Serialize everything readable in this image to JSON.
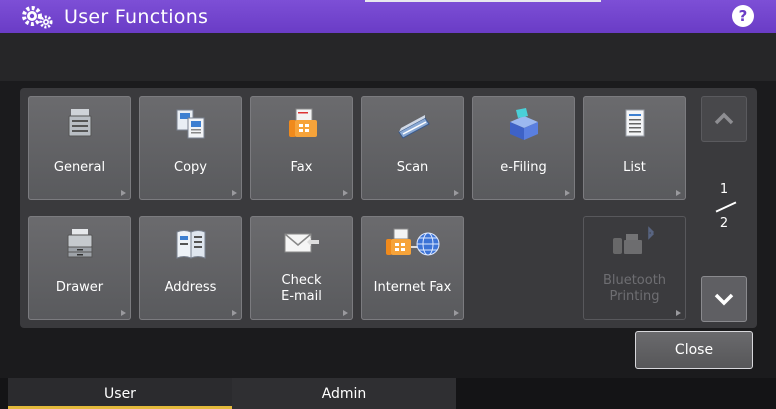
{
  "header": {
    "title": "User Functions",
    "help_label": "?"
  },
  "tiles": [
    {
      "label": "General",
      "icon": "copier-icon",
      "enabled": true
    },
    {
      "label": "Copy",
      "icon": "copy-pages-icon",
      "enabled": true
    },
    {
      "label": "Fax",
      "icon": "fax-icon",
      "enabled": true
    },
    {
      "label": "Scan",
      "icon": "scanner-icon",
      "enabled": true
    },
    {
      "label": "e-Filing",
      "icon": "e-filing-box-icon",
      "enabled": true
    },
    {
      "label": "List",
      "icon": "list-document-icon",
      "enabled": true
    },
    {
      "label": "Drawer",
      "icon": "drawer-printer-icon",
      "enabled": true
    },
    {
      "label": "Address",
      "icon": "address-book-icon",
      "enabled": true
    },
    {
      "label_line1": "Check",
      "label_line2": "E-mail",
      "icon": "envelope-icon",
      "enabled": true
    },
    {
      "label": "Internet Fax",
      "icon": "internet-fax-icon",
      "enabled": true
    },
    {
      "label_line1": "Bluetooth",
      "label_line2": "Printing",
      "icon": "bluetooth-printer-icon",
      "enabled": false
    }
  ],
  "pager": {
    "current": "1",
    "total": "2"
  },
  "close_label": "Close",
  "tabs": [
    {
      "label": "User",
      "active": true
    },
    {
      "label": "Admin",
      "active": false
    }
  ],
  "colors": {
    "header": "#6a3cc6",
    "active_tab_underline": "#e3b93b",
    "tile": "#636366"
  }
}
